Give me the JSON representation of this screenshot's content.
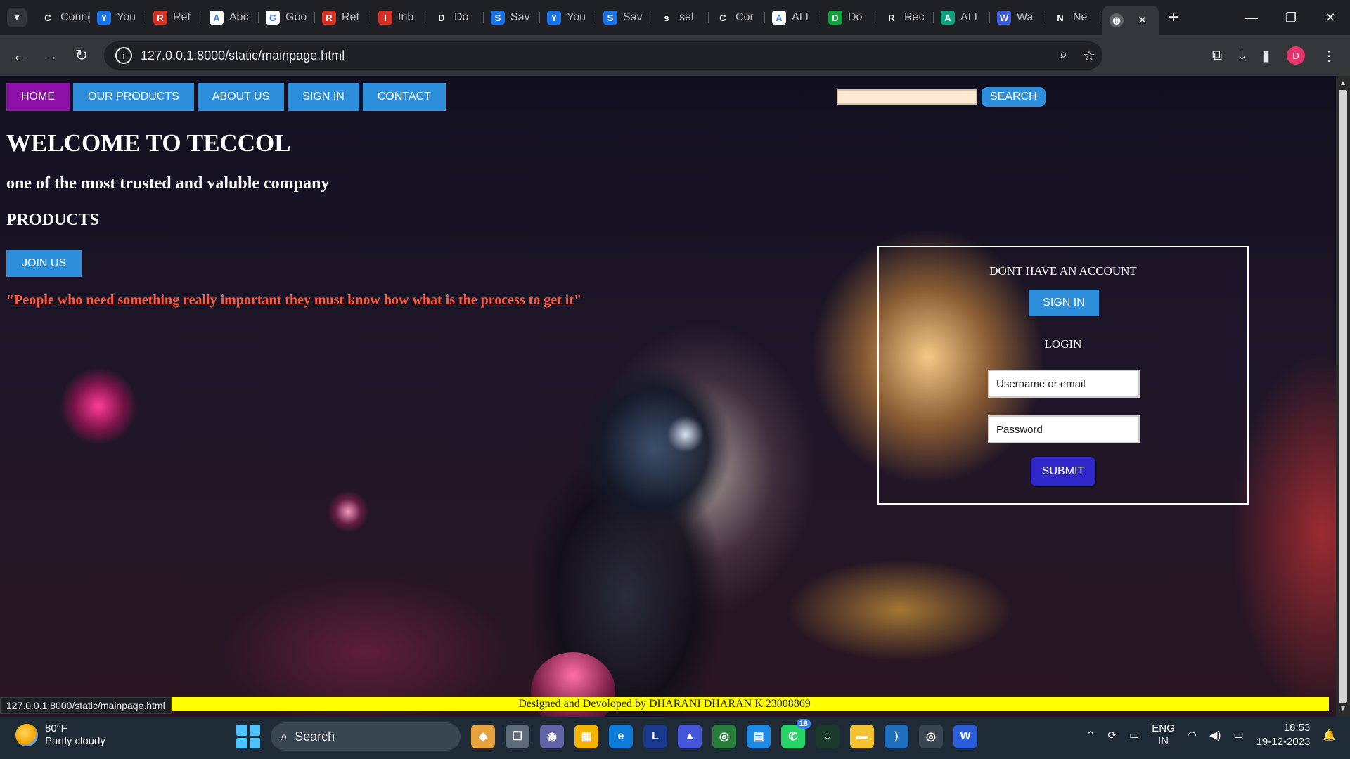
{
  "browser": {
    "tabs": [
      {
        "label": "Connec",
        "icon": "phone-link-icon",
        "color": "#202124"
      },
      {
        "label": "You",
        "icon": "s-app-icon",
        "color": "#1a73e8"
      },
      {
        "label": "Ref",
        "icon": "gmail-icon",
        "color": "#d93025"
      },
      {
        "label": "Abc",
        "icon": "google-icon",
        "color": "#ffffff"
      },
      {
        "label": "Goo",
        "icon": "google-icon",
        "color": "#ffffff"
      },
      {
        "label": "Ref",
        "icon": "gmail-icon",
        "color": "#d93025"
      },
      {
        "label": "Inb",
        "icon": "gmail-icon",
        "color": "#d93025"
      },
      {
        "label": "Do",
        "icon": "download-icon",
        "color": "#202124"
      },
      {
        "label": "Sav",
        "icon": "s-app-icon",
        "color": "#1a73e8"
      },
      {
        "label": "You",
        "icon": "s-app-icon",
        "color": "#1a73e8"
      },
      {
        "label": "Sav",
        "icon": "s-app-icon",
        "color": "#1a73e8"
      },
      {
        "label": "sel",
        "icon": "github-icon",
        "color": "#202124"
      },
      {
        "label": "Cor",
        "icon": "globe-icon",
        "color": "#202124"
      },
      {
        "label": "AI I",
        "icon": "google-icon",
        "color": "#ffffff"
      },
      {
        "label": "Do",
        "icon": "px-icon",
        "color": "#10a33b"
      },
      {
        "label": "Rec",
        "icon": "is-icon",
        "color": "#202124"
      },
      {
        "label": "AI I",
        "icon": "p-app-icon",
        "color": "#10a37f"
      },
      {
        "label": "Wa",
        "icon": "w-app-icon",
        "color": "#3b5bdb"
      },
      {
        "label": "Ne",
        "icon": "chrome-icon",
        "color": "#202124"
      }
    ],
    "active_tab_close": "✕",
    "new_tab": "+",
    "url": "127.0.0.1:8000/static/mainpage.html",
    "status_url": "127.0.0.1:8000/static/mainpage.html"
  },
  "site": {
    "nav": [
      "HOME",
      "OUR PRODUCTS",
      "ABOUT US",
      "SIGN IN",
      "CONTACT"
    ],
    "search_button": "SEARCH",
    "search_value": "",
    "welcome": "WELCOME TO TECCOL",
    "tagline": "one of the most trusted and valuble company",
    "products_heading": "PRODUCTS",
    "join_button": "JOIN US",
    "quote": "\"People who need something really important they must know how what is the process to get it\"",
    "account_box": {
      "title": "DONT HAVE AN ACCOUNT",
      "signin_button": "SIGN IN",
      "login_title": "LOGIN",
      "username_placeholder": "Username or email",
      "password_placeholder": "Password",
      "submit_button": "SUBMIT"
    },
    "footer": "Designed and Devoloped by DHARANI DHARAN K 23008869",
    "colors": {
      "nav_blue": "#2d8fdc",
      "home_purple": "#8c10a6",
      "quote_red": "#ff5a3d",
      "footer_yellow": "#ffff00",
      "submit_indigo": "#2f27c9"
    }
  },
  "taskbar": {
    "temperature": "80°F",
    "weather": "Partly cloudy",
    "search_label": "Search",
    "lang_top": "ENG",
    "lang_bottom": "IN",
    "time": "18:53",
    "date": "19-12-2023",
    "chrome_badge": "18"
  }
}
